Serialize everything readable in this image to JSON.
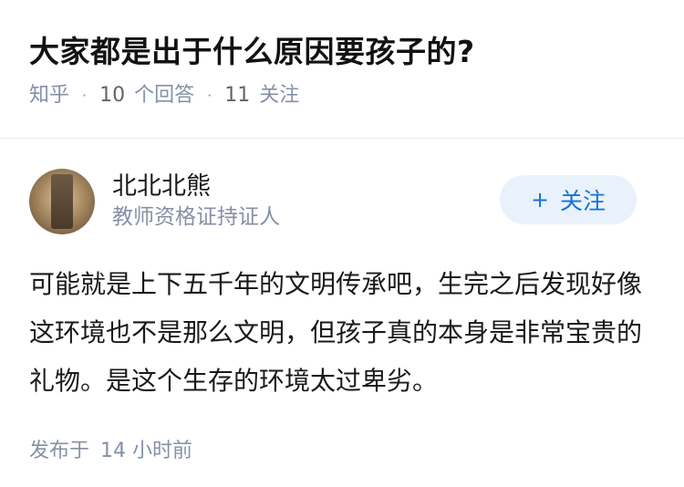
{
  "question": {
    "title": "大家都是出于什么原因要孩子的?",
    "source": "知乎",
    "answer_count": "10",
    "answer_label": "个回答",
    "follow_count": "11",
    "follow_label": "关注"
  },
  "answer": {
    "author": {
      "name": "北北北熊",
      "headline": "教师资格证持证人",
      "avatar_icon": "avatar-photo"
    },
    "follow_button": {
      "icon": "+",
      "label": "关注"
    },
    "content": "可能就是上下五千年的文明传承吧，生完之后发现好像这环境也不是那么文明，但孩子真的本身是非常宝贵的礼物。是这个生存的环境太过卑劣。",
    "published_label": "发布于",
    "published_time": "14 小时前"
  },
  "colors": {
    "accent": "#1772d8",
    "follow_bg": "#e9f2fb",
    "meta_text": "#8590a6"
  }
}
